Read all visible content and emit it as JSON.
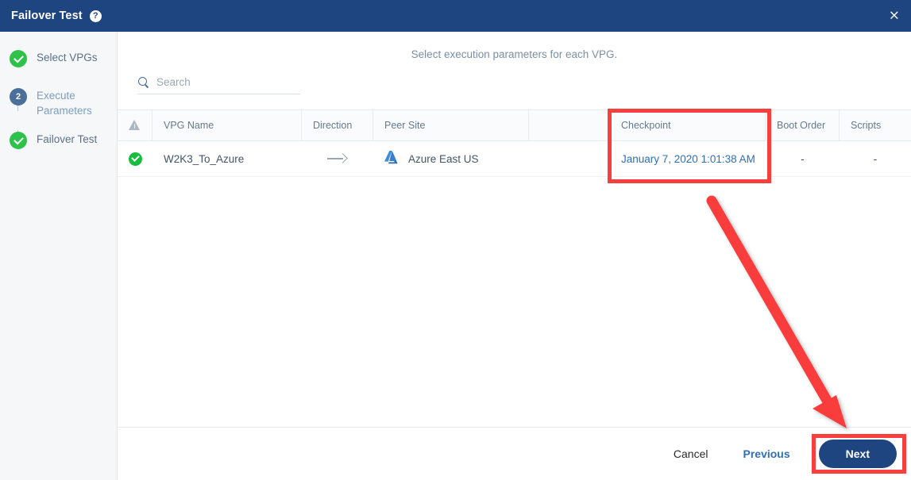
{
  "titlebar": {
    "title": "Failover Test",
    "help_icon": "help-icon",
    "close_icon": "×"
  },
  "sidebar": {
    "steps": [
      {
        "label": "Select VPGs",
        "state": "done",
        "marker": "check"
      },
      {
        "label": "Execute Parameters",
        "state": "current",
        "marker": "2"
      },
      {
        "label": "Failover Test",
        "state": "done",
        "marker": "check"
      }
    ]
  },
  "main": {
    "instruction": "Select execution parameters for each VPG."
  },
  "search": {
    "placeholder": "Search",
    "value": ""
  },
  "table": {
    "columns": [
      {
        "key": "status",
        "label": ""
      },
      {
        "key": "vpg_name",
        "label": "VPG Name"
      },
      {
        "key": "direction",
        "label": "Direction"
      },
      {
        "key": "peer_site",
        "label": "Peer Site"
      },
      {
        "key": "blank",
        "label": ""
      },
      {
        "key": "checkpoint",
        "label": "Checkpoint"
      },
      {
        "key": "boot_order",
        "label": "Boot Order"
      },
      {
        "key": "scripts",
        "label": "Scripts"
      }
    ],
    "rows": [
      {
        "status": "ok",
        "vpg_name": "W2K3_To_Azure",
        "direction": "arrow-right",
        "peer_site": "Azure East US",
        "peer_site_icon": "azure-logo",
        "checkpoint": "January 7, 2020 1:01:38 AM",
        "boot_order": "-",
        "scripts": "-"
      }
    ]
  },
  "footer": {
    "cancel_label": "Cancel",
    "previous_label": "Previous",
    "next_label": "Next"
  },
  "colors": {
    "header_blue": "#1f4580",
    "accent_link": "#2f6fb5",
    "success_green": "#16bd3f",
    "annotation_red": "#f93e3e",
    "sidebar_bg": "#f5f7f9"
  }
}
